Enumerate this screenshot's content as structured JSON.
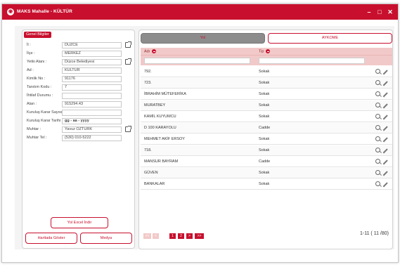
{
  "window": {
    "title": "MAKS Mahalle - KÜLTÜR",
    "minimize": "–",
    "maximize": "□",
    "close": "✕"
  },
  "left": {
    "group_label": "Genel Bilgiler",
    "fields": [
      {
        "label": "İl :",
        "value": "DÜZCE"
      },
      {
        "label": "İlçe :",
        "value": "MERKEZ"
      },
      {
        "label": "Yetki Alanı :",
        "value": "Düzce Belediyesi"
      },
      {
        "label": "Ad :",
        "value": "KÜLTÜR"
      },
      {
        "label": "Kimlik No :",
        "value": "91176"
      },
      {
        "label": "Tanıtım Kodu :",
        "value": "7"
      },
      {
        "label": "İhtilaf Durumu :",
        "value": ""
      },
      {
        "label": "Alan :",
        "value": "915294.43"
      },
      {
        "label": "Kuruluş Karar Sayısı :",
        "value": ""
      },
      {
        "label": "Kuruluş Karar Tarihi :",
        "value": "gg - aa - yyyy"
      },
      {
        "label": "Muhtar :",
        "value": "Yavuz ÖZTÜRK"
      },
      {
        "label": "Muhtar Tel :",
        "value": "(530) 010-5222"
      }
    ],
    "excel_button": "Yol Excel İndir",
    "map_button": "Haritada Göster",
    "media_button": "Medya"
  },
  "right": {
    "tabs": [
      "Yol",
      "AYKOME"
    ],
    "columns": {
      "name": "Adı",
      "type": "Tip"
    },
    "rows": [
      {
        "name": "792.",
        "type": "Sokak"
      },
      {
        "name": "723.",
        "type": "Sokak"
      },
      {
        "name": "İBRAHİM MÜTEFERİKA",
        "type": "Sokak"
      },
      {
        "name": "MURATBEY",
        "type": "Sokak"
      },
      {
        "name": "KAMİL KUYUMCU",
        "type": "Sokak"
      },
      {
        "name": "D 100 KARAYOLU",
        "type": "Cadde"
      },
      {
        "name": "MEHMET AKİF ERSOY",
        "type": "Sokak"
      },
      {
        "name": "718.",
        "type": "Sokak"
      },
      {
        "name": "MANSUR BAYRAM",
        "type": "Cadde"
      },
      {
        "name": "GÜVEN",
        "type": "Sokak"
      },
      {
        "name": "BANKALAR",
        "type": "Sokak"
      }
    ],
    "pager": {
      "first": "<<",
      "prev": "<",
      "pages": [
        "1",
        "2"
      ],
      "next": ">",
      "last": ">>",
      "info": "1-11 ( 11 /80)"
    }
  },
  "colors": {
    "accent": "#c8102e",
    "header_bg": "#f2c9c9",
    "tab_active_bg": "#8c8c8c"
  }
}
